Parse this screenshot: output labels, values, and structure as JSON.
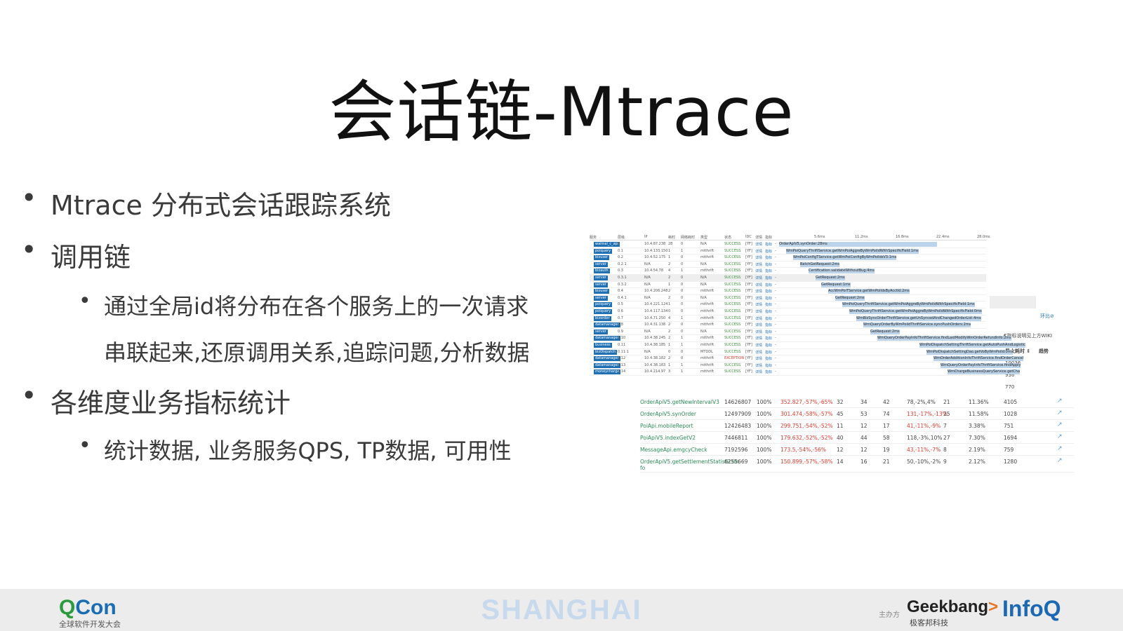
{
  "slide": {
    "title": "会话链-Mtrace",
    "bullets": [
      {
        "text": "Mtrace 分布式会话跟踪系统"
      },
      {
        "text": "调用链"
      },
      {
        "text": "通过全局id将分布在各个服务上的一次请求",
        "cont": "串联起来,还原调用关系,追踪问题,分析数据"
      },
      {
        "text": "各维度业务指标统计"
      },
      {
        "text": "统计数据, 业务服务QPS, TP数据, 可用性"
      }
    ]
  },
  "trace": {
    "headers": [
      "服务",
      "层级",
      "IP",
      "耗时",
      "网络耗时",
      "类型",
      "状态",
      "IDC",
      "详情",
      "指标",
      "5.6ms",
      "11.2ms",
      "16.8ms",
      "22.4ms",
      "28.0ms"
    ],
    "rows": [
      {
        "svc": "waimai_c_api",
        "lvl": "0",
        "ip": "10.4.87.238",
        "cost": "28",
        "net": "0",
        "type": "N/A",
        "status": "SUCCESS",
        "bar": "OrderApiV5.synOrder:28ms",
        "off": 0,
        "w": 225
      },
      {
        "svc": "poiquery",
        "lvl": "0.1",
        "ip": "10.4.133.150",
        "cost": "1",
        "net": "1",
        "type": "mtthrift",
        "status": "SUCCESS",
        "bar": "WmPoiQueryThriftService.getWmPoiAggreByWmPoiIdWithSpecificField:1ms",
        "off": 10,
        "w": 6
      },
      {
        "svc": "bizuser",
        "lvl": "0.2",
        "ip": "10.4.52.175",
        "cost": "1",
        "net": "0",
        "type": "mtthrift",
        "status": "SUCCESS",
        "bar": "WmPoiConfigTService.getWmPoiConfigByWmPoiIdsV3:1ms",
        "off": 20,
        "w": 6
      },
      {
        "svc": "server",
        "lvl": "0.2.1",
        "ip": "N/A",
        "cost": "2",
        "net": "0",
        "type": "N/A",
        "status": "SUCCESS",
        "bar": "BatchGetRequest:2ms",
        "off": 30,
        "w": 12
      },
      {
        "svc": "bizauth",
        "lvl": "0.3",
        "ip": "10.4.54.78",
        "cost": "4",
        "net": "1",
        "type": "mtthrift",
        "status": "SUCCESS",
        "bar": "Certification.validateWithoutBug:4ms",
        "off": 42,
        "w": 24
      },
      {
        "svc": "server",
        "lvl": "0.3.1",
        "ip": "N/A",
        "cost": "2",
        "net": "0",
        "type": "N/A",
        "status": "SUCCESS",
        "bar": "GetRequest:2ms",
        "off": 52,
        "w": 12,
        "sel": true
      },
      {
        "svc": "server",
        "lvl": "0.3.2",
        "ip": "N/A",
        "cost": "1",
        "net": "0",
        "type": "N/A",
        "status": "SUCCESS",
        "bar": "GetRequest:1ms",
        "off": 60,
        "w": 6
      },
      {
        "svc": "bizuser",
        "lvl": "0.4",
        "ip": "10.4.206.248",
        "cost": "2",
        "net": "0",
        "type": "mtthrift",
        "status": "SUCCESS",
        "bar": "AccWmPoiTService.getWmPoiIdsByAcctId:2ms",
        "off": 70,
        "w": 12
      },
      {
        "svc": "server",
        "lvl": "0.4.1",
        "ip": "N/A",
        "cost": "2",
        "net": "0",
        "type": "N/A",
        "status": "SUCCESS",
        "bar": "GetRequest:2ms",
        "off": 80,
        "w": 12
      },
      {
        "svc": "poiquery",
        "lvl": "0.5",
        "ip": "10.4.221.124",
        "cost": "1",
        "net": "0",
        "type": "mtthrift",
        "status": "SUCCESS",
        "bar": "WmPoiQueryThriftService.getWmPoiAggreByWmPoiIdWithSpecificField:1ms",
        "off": 90,
        "w": 6
      },
      {
        "svc": "poiquery",
        "lvl": "0.6",
        "ip": "10.4.117.134",
        "cost": "0",
        "net": "0",
        "type": "mtthrift",
        "status": "SUCCESS",
        "bar": "WmPoiQueryThriftService.getWmPoiAggreByWmPoiIdWithSpecificField:0ms",
        "off": 100,
        "w": 3
      },
      {
        "svc": "bizorder",
        "lvl": "0.7",
        "ip": "10.4.71.250",
        "cost": "4",
        "net": "1",
        "type": "mtthrift",
        "status": "SUCCESS",
        "bar": "WmBizSyncOrderThriftService.getUnSyncedAndChangedOrderList:4ms",
        "off": 110,
        "w": 24
      },
      {
        "svc": "datamanager",
        "lvl": "0.8",
        "ip": "10.4.31.138",
        "cost": "2",
        "net": "0",
        "type": "mtthrift",
        "status": "SUCCESS",
        "bar": "WmQueryOrderByWmPoiIdThriftService.syncPushOrders:2ms",
        "off": 120,
        "w": 12
      },
      {
        "svc": "server",
        "lvl": "0.9",
        "ip": "N/A",
        "cost": "2",
        "net": "0",
        "type": "N/A",
        "status": "SUCCESS",
        "bar": "GetRequest:2ms",
        "off": 130,
        "w": 12
      },
      {
        "svc": "datamanager",
        "lvl": "0.10",
        "ip": "10.4.38.245",
        "cost": "2",
        "net": "1",
        "type": "mtthrift",
        "status": "SUCCESS",
        "bar": "WmQueryOrderPayInfoThriftService.findLastModifyWmOrderRefundInfo:2ms",
        "off": 140,
        "w": 12
      },
      {
        "svc": "business",
        "lvl": "0.11",
        "ip": "10.4.38.185",
        "cost": "1",
        "net": "1",
        "type": "mtthrift",
        "status": "SUCCESS",
        "bar": "WmPoiDispatchSettingThriftService.getAutoPushAndLogistic",
        "off": 200,
        "w": 6
      },
      {
        "svc": "bizDispatch",
        "lvl": "0.11.1",
        "ip": "N/A",
        "cost": "0",
        "net": "0",
        "type": "MTDDL",
        "status": "SUCCESS",
        "bar": "WmPoiDispatchSettingDao.getVoByWmPoiId:0ms",
        "off": 210,
        "w": 3
      },
      {
        "svc": "datamanager",
        "lvl": "0.12",
        "ip": "10.4.38.182",
        "cost": "2",
        "net": "0",
        "type": "mtthrift",
        "status": "EXCEPTION",
        "bar": "WmOrderAdditionInfoThriftService.findOrderCancel",
        "off": 220,
        "w": 12
      },
      {
        "svc": "datamanager",
        "lvl": "0.13",
        "ip": "10.4.38.183",
        "cost": "1",
        "net": "1",
        "type": "mtthrift",
        "status": "SUCCESS",
        "bar": "WmQueryOrderPayInfoThriftService.findApply",
        "off": 230,
        "w": 6
      },
      {
        "svc": "moneycharge",
        "lvl": "0.14",
        "ip": "10.4.214.97",
        "cost": "3",
        "net": "1",
        "type": "mtthrift",
        "status": "SUCCESS",
        "bar": "WmChargeBusinessQueryService.getCha",
        "off": 240,
        "w": 18
      }
    ],
    "cols": {
      "idc": "[YF]",
      "detail": "详情",
      "metric": "指标",
      "dash": "-"
    }
  },
  "stats": {
    "side_link": "环比⊘",
    "side_note": "€指标说明见上方WIKI",
    "headers": [
      "最大耗时 ⇕",
      "趋势"
    ],
    "partial_rows": [
      {
        "max": "10036"
      },
      {
        "max": "936"
      },
      {
        "max": "770"
      }
    ],
    "rows": [
      {
        "api": "OrderApiV5.getNewIntervalV3",
        "count": "14626807",
        "rate": "100%",
        "qps": "352.827,-57%,-65%",
        "a": "32",
        "b": "34",
        "c": "42",
        "tp": "78,-2%,4%",
        "d": "21",
        "pct": "11.36%",
        "max": "4105"
      },
      {
        "api": "OrderApiV5.synOrder",
        "count": "12497909",
        "rate": "100%",
        "qps": "301.474,-58%,-57%",
        "a": "45",
        "b": "53",
        "c": "74",
        "tp": "131,-17%,-13%",
        "d": "25",
        "pct": "11.58%",
        "max": "1028",
        "tpred": true
      },
      {
        "api": "PoiApi.mobileReport",
        "count": "12426483",
        "rate": "100%",
        "qps": "299.751,-54%,-52%",
        "a": "11",
        "b": "12",
        "c": "17",
        "tp": "41,-11%,-9%",
        "d": "7",
        "pct": "3.38%",
        "max": "751",
        "tpred": true
      },
      {
        "api": "PoiApiV5.indexGetV2",
        "count": "7446811",
        "rate": "100%",
        "qps": "179.632,-52%,-52%",
        "a": "40",
        "b": "44",
        "c": "58",
        "tp": "118,-3%,10%",
        "d": "27",
        "pct": "7.30%",
        "max": "1694"
      },
      {
        "api": "MessageApi.emgcyCheck",
        "count": "7192596",
        "rate": "100%",
        "qps": "173.5,-54%,-56%",
        "a": "12",
        "b": "12",
        "c": "19",
        "tp": "43,-11%,-7%",
        "d": "8",
        "pct": "2.19%",
        "max": "759",
        "tpred": true
      },
      {
        "api": "OrderApiV5.getSettlementStatisticsIn",
        "api2": "fo",
        "count": "6255669",
        "rate": "100%",
        "qps": "150.899,-57%,-58%",
        "a": "14",
        "b": "16",
        "c": "21",
        "tp": "50,-10%,-2%",
        "d": "9",
        "pct": "2.12%",
        "max": "1280"
      }
    ]
  },
  "footer": {
    "logo_q": "Q",
    "logo_con": "Con",
    "logo_sub": "全球软件开发大会",
    "city": "SHANGHAI",
    "host": "主办方",
    "geek": "Geekbang",
    "geek_arrow": ">",
    "geek_sub": "极客邦科技",
    "infoq": "InfoQ"
  },
  "colors": {
    "accent": "#1f6fb3",
    "success": "#3a8d3a",
    "error": "#d9362b",
    "api": "#2a8a57"
  }
}
